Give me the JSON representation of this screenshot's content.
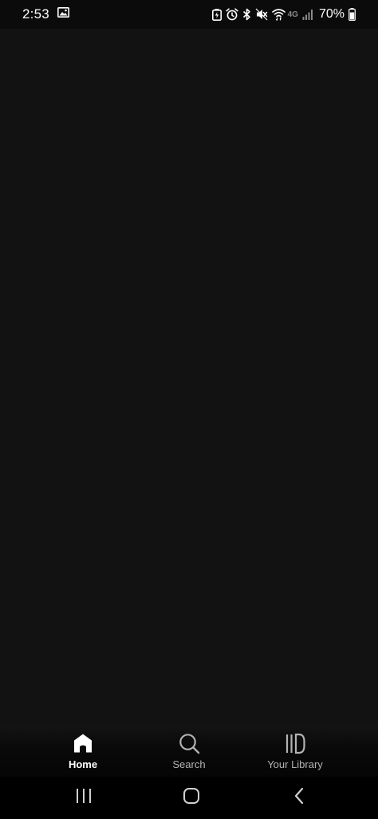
{
  "status_bar": {
    "time": "2:53",
    "battery_percent": "70%",
    "network_label": "4G",
    "icons": [
      "gallery-icon",
      "battery-saver-icon",
      "alarm-icon",
      "bluetooth-icon",
      "mute-icon",
      "wifi-icon",
      "signal-icon",
      "battery-icon"
    ]
  },
  "tabs": [
    {
      "id": "home",
      "label": "Home",
      "icon": "home-icon",
      "active": true
    },
    {
      "id": "search",
      "label": "Search",
      "icon": "search-icon",
      "active": false
    },
    {
      "id": "library",
      "label": "Your Library",
      "icon": "library-icon",
      "active": false
    }
  ],
  "nav_bar": {
    "buttons": [
      "recent-apps-icon",
      "home-circle-icon",
      "back-icon"
    ]
  },
  "colors": {
    "background": "#121212",
    "status_bar": "#0b0b0b",
    "active_text": "#ffffff",
    "inactive_text": "#b3b3b3"
  }
}
